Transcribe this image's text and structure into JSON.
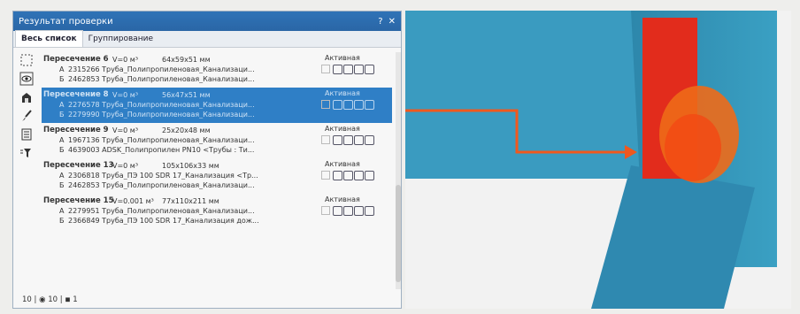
{
  "panel": {
    "title": "Результат проверки",
    "help_label": "?",
    "close_label": "✕"
  },
  "tabs": [
    {
      "label": "Весь список"
    },
    {
      "label": "Группирование"
    }
  ],
  "status_header": "Активная",
  "groups": [
    {
      "name": "Пересечение 6",
      "volume": "V=0 м³",
      "size": "64x59x51 мм",
      "status": "Активная",
      "items": [
        {
          "letter": "А",
          "text": "2315266 Труба_Полипропиленовая_Канализаци..."
        },
        {
          "letter": "Б",
          "text": "2462853 Труба_Полипропиленовая_Канализаци..."
        }
      ]
    },
    {
      "name": "Пересечение 8",
      "volume": "V=0 м³",
      "size": "56x47x51 мм",
      "status": "Активная",
      "items": [
        {
          "letter": "А",
          "text": "2276578 Труба_Полипропиленовая_Канализаци..."
        },
        {
          "letter": "Б",
          "text": "2279990 Труба_Полипропиленовая_Канализаци..."
        }
      ]
    },
    {
      "name": "Пересечение 9",
      "volume": "V=0 м³",
      "size": "25x20x48 мм",
      "status": "Активная",
      "items": [
        {
          "letter": "А",
          "text": "1967136 Труба_Полипропиленовая_Канализаци..."
        },
        {
          "letter": "Б",
          "text": "4639003 ADSK_Полипропилен PN10 <Трубы : Ти..."
        }
      ]
    },
    {
      "name": "Пересечение 13",
      "volume": "V=0 м³",
      "size": "105x106x33 мм",
      "status": "Активная",
      "items": [
        {
          "letter": "А",
          "text": "2306818 Труба_ПЭ 100 SDR 17_Канализация <Тр..."
        },
        {
          "letter": "Б",
          "text": "2462853 Труба_Полипропиленовая_Канализаци..."
        }
      ]
    },
    {
      "name": "Пересечение 15",
      "volume": "V=0.001 м³",
      "size": "77x110x211 мм",
      "status": "Активная",
      "items": [
        {
          "letter": "А",
          "text": "2279951 Труба_Полипропиленовая_Канализаци..."
        },
        {
          "letter": "Б",
          "text": "2366849 Труба_ПЭ 100 SDR 17_Канализация дож..."
        }
      ]
    }
  ],
  "statusbar": {
    "count": "10",
    "visible": "10",
    "hidden": "1"
  },
  "colors": {
    "selection": "#2f7fc6",
    "pipe": "#2f8fb3",
    "clash": "#e8281e",
    "arrow": "#f0581e"
  },
  "icons": [
    "select-box-icon",
    "eye-icon",
    "home-view-icon",
    "brush-icon",
    "report-icon",
    "filter-icon"
  ]
}
